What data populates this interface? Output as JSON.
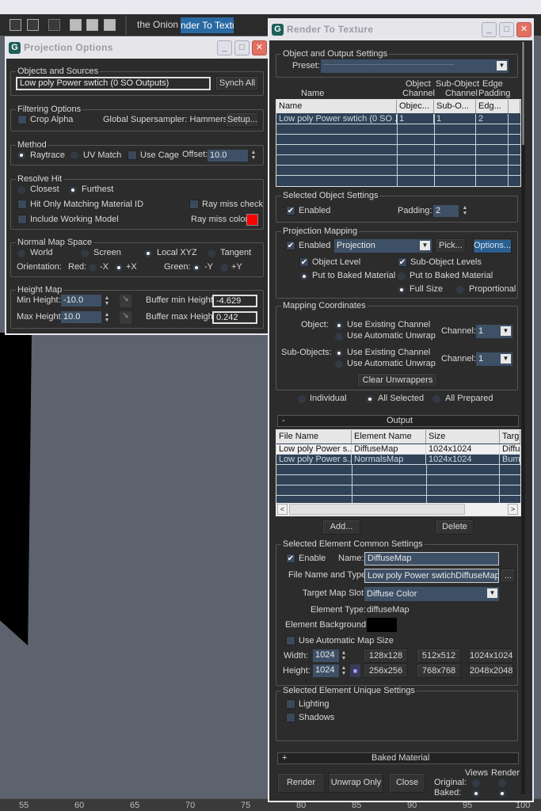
{
  "toolbar": {
    "tab1": "the Onion",
    "tab2": "nder To Textu",
    "icons": [
      "schematic-icon",
      "material-editor-icon",
      "curve-icon",
      "render-setup-icon",
      "rendered-frame-icon",
      "render-icon"
    ]
  },
  "timeline": {
    "ticks": [
      "55",
      "60",
      "65",
      "70",
      "75",
      "80",
      "85",
      "90",
      "95",
      "100"
    ]
  },
  "proj": {
    "title": "Projection Options",
    "logo": "G",
    "objects": {
      "label": "Objects and Sources",
      "value": "Low poly Power swtich (0 SO Outputs)",
      "synch": "Synch All"
    },
    "filtering": {
      "label": "Filtering Options",
      "crop_alpha": "Crop Alpha",
      "crop_alpha_checked": false,
      "supersampler": "Global Supersampler: Hammersley",
      "setup": "Setup..."
    },
    "method": {
      "label": "Method",
      "raytrace": "Raytrace",
      "uv_match": "UV Match",
      "selected": "Raytrace",
      "use_cage": "Use Cage",
      "use_cage_checked": false,
      "offset_label": "Offset:",
      "offset": "10.0"
    },
    "resolve": {
      "label": "Resolve Hit",
      "closest": "Closest",
      "furthest": "Furthest",
      "selected": "Furthest",
      "hit_only": "Hit Only Matching Material ID",
      "ray_miss_check": "Ray miss check",
      "include_working": "Include Working Model",
      "ray_miss_color": "Ray miss color:",
      "ray_miss_color_value": "#ff0000"
    },
    "normal": {
      "label": "Normal Map Space",
      "world": "World",
      "screen": "Screen",
      "local": "Local XYZ",
      "tangent": "Tangent",
      "selected": "Local XYZ",
      "orientation": "Orientation:",
      "red": "Red:",
      "neg_x": "-X",
      "pos_x": "+X",
      "red_selected": "+X",
      "green": "Green:",
      "neg_y": "-Y",
      "pos_y": "+Y",
      "green_selected": "-Y"
    },
    "height": {
      "label": "Height Map",
      "min_label": "Min Height:",
      "min": "-10.0",
      "max_label": "Max Height:",
      "max": "10.0",
      "buf_min_label": "Buffer min Height:",
      "buf_min": "-4.629",
      "buf_max_label": "Buffer max Height:",
      "buf_max": "0.242"
    }
  },
  "rtt": {
    "title": "Render To Texture",
    "logo": "G",
    "oos": {
      "label": "Object and Output Settings",
      "preset_label": "Preset:",
      "preset": "-----------------------------------------------------------------------------------",
      "col_heads": {
        "name": "Name",
        "obj1": "Object",
        "obj2": "Channel",
        "sub1": "Sub-Object",
        "sub2": "Channel",
        "edge1": "Edge",
        "edge2": "Padding"
      },
      "table_headers": [
        "Name",
        "Objec...",
        "Sub-O...",
        "Edg..."
      ],
      "rows": [
        [
          "Low poly Power swtich (0 SO ...",
          "1",
          "1",
          "2"
        ]
      ]
    },
    "sos": {
      "label": "Selected Object Settings",
      "enabled": "Enabled",
      "enabled_checked": true,
      "padding_label": "Padding:",
      "padding": "2"
    },
    "pm": {
      "label": "Projection Mapping",
      "enabled": "Enabled",
      "enabled_checked": true,
      "mode": "Projection",
      "pick": "Pick...",
      "options": "Options...",
      "object_level": "Object Level",
      "sub_levels": "Sub-Object Levels",
      "put_baked": "Put to Baked Material",
      "put_baked2": "Put to Baked Material",
      "full_size": "Full Size",
      "proportional": "Proportional"
    },
    "mc": {
      "label": "Mapping Coordinates",
      "object": "Object:",
      "sub_objects": "Sub-Objects:",
      "use_existing": "Use Existing Channel",
      "use_auto": "Use Automatic Unwrap",
      "channel_label": "Channel:",
      "object_channel": "1",
      "sub_channel": "1",
      "clear": "Clear Unwrappers"
    },
    "scope": {
      "individual": "Individual",
      "all_selected": "All Selected",
      "all_prepared": "All Prepared",
      "selected": "All Selected"
    },
    "output": {
      "toggle": "-",
      "label": "Output",
      "headers": [
        "File Name",
        "Element Name",
        "Size",
        "Targ"
      ],
      "rows": [
        [
          "Low poly Power s...",
          "DiffuseMap",
          "1024x1024",
          "Diffu"
        ],
        [
          "Low poly Power s...",
          "NormalsMap",
          "1024x1024",
          "Bum"
        ]
      ],
      "add": "Add...",
      "delete": "Delete"
    },
    "secs": {
      "label": "Selected Element Common Settings",
      "enable": "Enable",
      "enable_checked": true,
      "name_label": "Name:",
      "name": "DiffuseMap",
      "file_label": "File Name and Type:",
      "file": "Low poly Power swtichDiffuseMap.tga",
      "browse": "...",
      "slot_label": "Target Map Slot:",
      "slot": "Diffuse Color",
      "type_label": "Element Type:",
      "type": "diffuseMap",
      "bg_label": "Element Background:",
      "bg_color": "#000000",
      "auto_size": "Use Automatic Map Size",
      "width_label": "Width:",
      "width": "1024",
      "height_label": "Height:",
      "height": "1024",
      "sizes": [
        "128x128",
        "512x512",
        "1024x1024",
        "256x256",
        "768x768",
        "2048x2048"
      ]
    },
    "seus": {
      "label": "Selected Element Unique Settings",
      "lighting": "Lighting",
      "shadows": "Shadows"
    },
    "baked": {
      "toggle": "+",
      "label": "Baked Material"
    },
    "footer": {
      "render": "Render",
      "unwrap": "Unwrap Only",
      "close": "Close",
      "views": "Views",
      "render_col": "Render",
      "original": "Original:",
      "baked": "Baked:"
    }
  }
}
